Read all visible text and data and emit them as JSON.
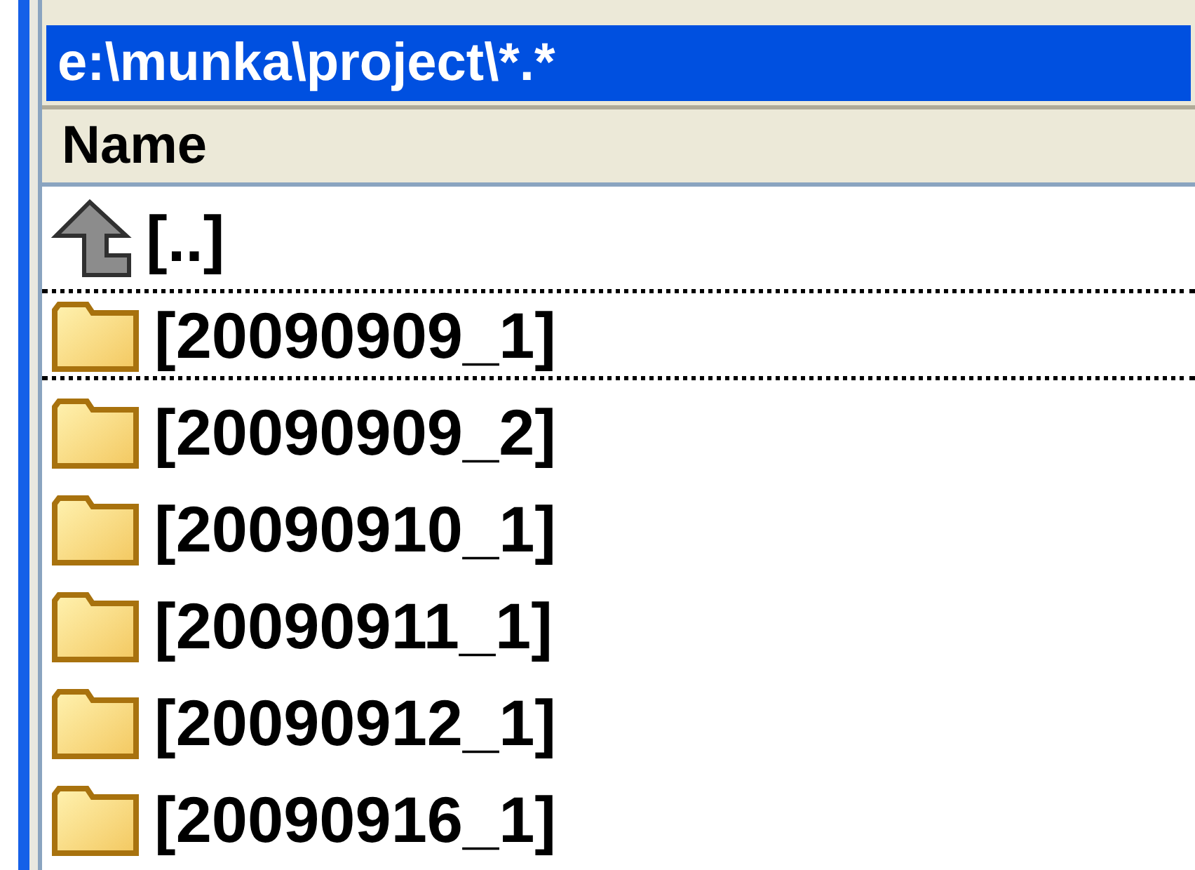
{
  "path_bar": {
    "text": "e:\\munka\\project\\*.*"
  },
  "columns": [
    "Name"
  ],
  "items": [
    {
      "kind": "up",
      "name": "[..]",
      "focused": false
    },
    {
      "kind": "folder",
      "name": "[20090909_1]",
      "focused": true
    },
    {
      "kind": "folder",
      "name": "[20090909_2]",
      "focused": false
    },
    {
      "kind": "folder",
      "name": "[20090910_1]",
      "focused": false
    },
    {
      "kind": "folder",
      "name": "[20090911_1]",
      "focused": false
    },
    {
      "kind": "folder",
      "name": "[20090912_1]",
      "focused": false
    },
    {
      "kind": "folder",
      "name": "[20090916_1]",
      "focused": false
    }
  ]
}
